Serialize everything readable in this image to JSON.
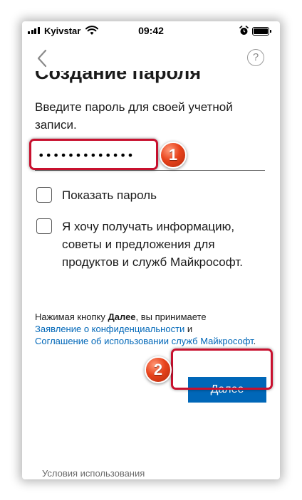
{
  "status_bar": {
    "carrier": "Kyivstar",
    "time": "09:42"
  },
  "nav": {
    "back_icon": "chevron-left-icon",
    "help_icon": "question-circle-icon",
    "help_glyph": "?"
  },
  "page": {
    "heading": "Создание пароля",
    "instruction": "Введите пароль для своей учетной записи.",
    "password_value": "•••••••••••••",
    "show_password_label": "Показать пароль",
    "info_opt_in_label": "Я хочу получать информацию, советы и предложения для продуктов и служб Майкрософт.",
    "legal": {
      "prefix": "Нажимая кнопку ",
      "button_ref": "Далее",
      "middle": ", вы принимаете",
      "privacy_link": "Заявление о конфиденциальности",
      "and": " и",
      "services_link": "Соглашение об использовании служб Майкрософт",
      "suffix": "."
    },
    "next_button": "Далее",
    "footer": "Условия использования"
  },
  "annotations": {
    "step1": "1",
    "step2": "2",
    "highlight_color": "#c8102e",
    "badge_color": "#e8431c"
  },
  "colors": {
    "accent": "#0067b8",
    "text": "#1b1b1b"
  }
}
